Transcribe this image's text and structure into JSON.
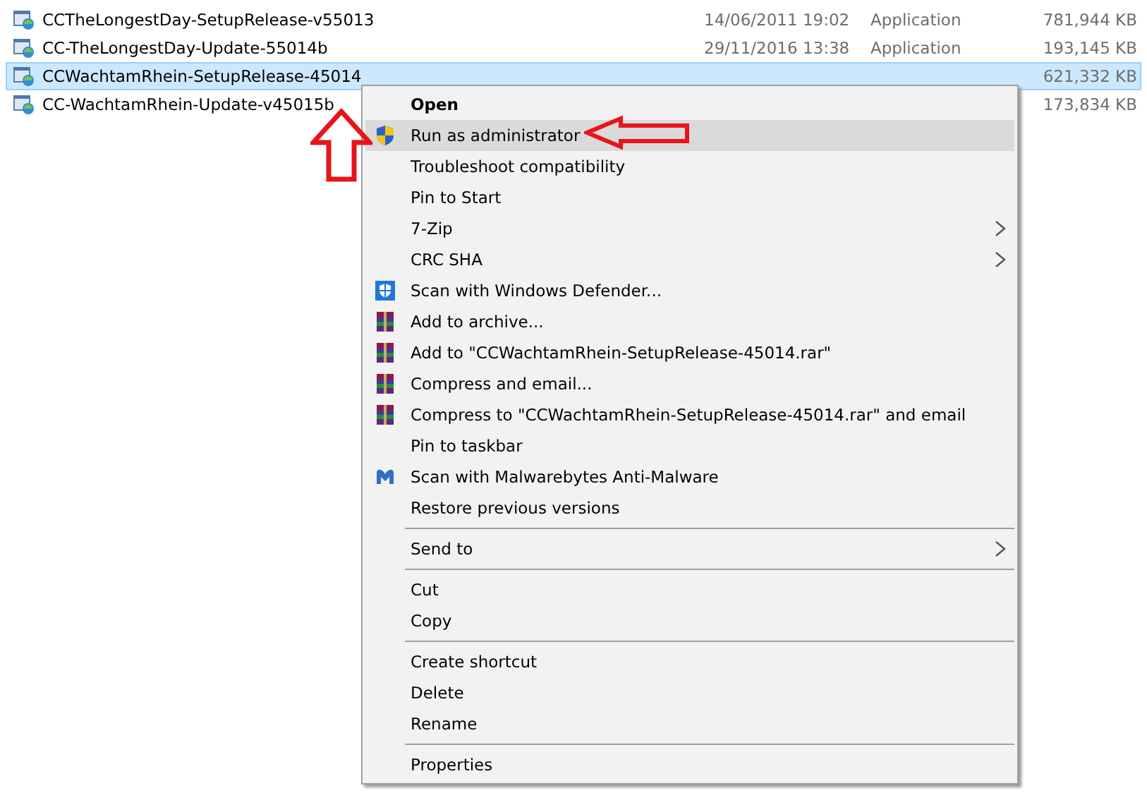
{
  "files": [
    {
      "name": "CCTheLongestDay-SetupRelease-v55013",
      "date": "14/06/2011 19:02",
      "type": "Application",
      "size": "781,944 KB",
      "selected": false
    },
    {
      "name": "CC-TheLongestDay-Update-55014b",
      "date": "29/11/2016 13:38",
      "type": "Application",
      "size": "193,145 KB",
      "selected": false
    },
    {
      "name": "CCWachtamRhein-SetupRelease-45014",
      "size": "621,332 KB",
      "selected": true
    },
    {
      "name": "CC-WachtamRhein-Update-v45015b",
      "size": "173,834 KB",
      "selected": false
    }
  ],
  "context_menu": [
    {
      "kind": "plain",
      "label": "Open",
      "default": true,
      "selected": false,
      "submenu": false
    },
    {
      "kind": "shield",
      "label": "Run as administrator",
      "default": false,
      "selected": true,
      "submenu": false
    },
    {
      "kind": "plain",
      "label": "Troubleshoot compatibility",
      "default": false,
      "selected": false,
      "submenu": false
    },
    {
      "kind": "plain",
      "label": "Pin to Start",
      "default": false,
      "selected": false,
      "submenu": false
    },
    {
      "kind": "plain",
      "label": "7-Zip",
      "default": false,
      "selected": false,
      "submenu": true
    },
    {
      "kind": "plain",
      "label": "CRC SHA",
      "default": false,
      "selected": false,
      "submenu": true
    },
    {
      "kind": "defender",
      "label": "Scan with Windows Defender...",
      "default": false,
      "selected": false,
      "submenu": false
    },
    {
      "kind": "archive",
      "label": "Add to archive...",
      "default": false,
      "selected": false,
      "submenu": false
    },
    {
      "kind": "archive",
      "label": "Add to \"CCWachtamRhein-SetupRelease-45014.rar\"",
      "default": false,
      "selected": false,
      "submenu": false
    },
    {
      "kind": "archive",
      "label": "Compress and email...",
      "default": false,
      "selected": false,
      "submenu": false
    },
    {
      "kind": "archive",
      "label": "Compress to \"CCWachtamRhein-SetupRelease-45014.rar\" and email",
      "default": false,
      "selected": false,
      "submenu": false
    },
    {
      "kind": "plain",
      "label": "Pin to taskbar",
      "default": false,
      "selected": false,
      "submenu": false
    },
    {
      "kind": "malware",
      "label": "Scan with Malwarebytes Anti-Malware",
      "default": false,
      "selected": false,
      "submenu": false
    },
    {
      "kind": "plain",
      "label": "Restore previous versions",
      "default": false,
      "selected": false,
      "submenu": false
    },
    {
      "kind": "separator"
    },
    {
      "kind": "plain",
      "label": "Send to",
      "default": false,
      "selected": false,
      "submenu": true
    },
    {
      "kind": "separator"
    },
    {
      "kind": "plain",
      "label": "Cut",
      "default": false,
      "selected": false,
      "submenu": false
    },
    {
      "kind": "plain",
      "label": "Copy",
      "default": false,
      "selected": false,
      "submenu": false
    },
    {
      "kind": "separator"
    },
    {
      "kind": "plain",
      "label": "Create shortcut",
      "default": false,
      "selected": false,
      "submenu": false
    },
    {
      "kind": "plain",
      "label": "Delete",
      "default": false,
      "selected": false,
      "submenu": false
    },
    {
      "kind": "plain",
      "label": "Rename",
      "default": false,
      "selected": false,
      "submenu": false
    },
    {
      "kind": "separator"
    },
    {
      "kind": "plain",
      "label": "Properties",
      "default": false,
      "selected": false,
      "submenu": false
    }
  ]
}
